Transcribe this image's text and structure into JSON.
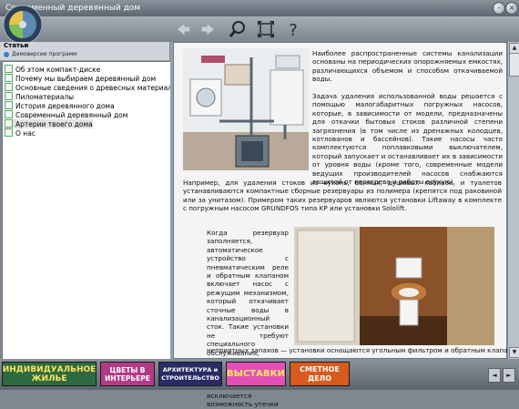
{
  "window": {
    "title": "Современный деревянный дом",
    "minimize_glyph": "–",
    "close_glyph": "×"
  },
  "toolbar": {
    "buttons": [
      "back-arrow-icon",
      "forward-arrow-icon",
      "search-magnifier-icon",
      "fullscreen-icon",
      "help-question-icon"
    ]
  },
  "sidebar": {
    "section_title": "Статьи",
    "section_subtitle": "Демоверсии программ",
    "items": [
      {
        "label": "Об этом компакт-диске",
        "selected": false
      },
      {
        "label": "Почему мы выбираем деревянный дом",
        "selected": false
      },
      {
        "label": "Основные сведения о древесных материалах",
        "selected": false
      },
      {
        "label": "Пиломатериалы",
        "selected": false
      },
      {
        "label": "История деревянного дома",
        "selected": false
      },
      {
        "label": "Современный деревянный дом",
        "selected": false
      },
      {
        "label": "Артерии твоего дома",
        "selected": true
      },
      {
        "label": "О нас",
        "selected": false
      }
    ]
  },
  "article": {
    "p1": "Наиболее распространенные системы канализации основаны на периодических опорожняемых емкостях, различающихся объемом и способом откачиваемой воды.",
    "p2": "Задача удаления использованной воды решается с помощью малогабаритных погружных насосов, которые, в зависимости от модели, предназначены для откачки бытовых стоков различной степени загрязнения (в том числе из дренажных колодцев, котлованов и бассейнов). Такие насосы часто комплектуются поплавковыми выключателем, который запускает и останавливает их в зависимости от уровня воды (кроме того, современные модели ведущих производителей насосов снабжаются защитой от перегрева и работы всухую).",
    "p3": "Например, для удаления стоков из кухонь, ванных, душевых кабинок, и туалетов устанавливаются компактные сборные резервуары из полимера (крепятся под раковиной или за унитазом). Примером таких резервуаров являются установки Liftaway в комплекте с погружным насосом GRUNDFOS типа KP или установки Sololift.",
    "p4": "Когда резервуар заполняется, автоматическое устройство с пневматическим реле и обратным клапаном включает насос с режущим механизмом, который откачивает сточные воды в канализационный сток. Такие установки не требуют специального обслуживания, поскольку их конструкция обеспечивает самоочистку. Также исключается возможность утечки",
    "p5": "неприятных запахов — установки оснащаются угольным фильтром и обратным клапаном."
  },
  "banners": [
    {
      "line1": "ИНДИВИДУАЛЬНОЕ",
      "line2": "ЖИЛЬЕ",
      "bg": "#2e6a3f",
      "fg": "#ffe45c"
    },
    {
      "line1": "ЦВЕТЫ В",
      "line2": "ИНТЕРЬЕРЕ",
      "bg": "#b33a86",
      "fg": "#ffffff"
    },
    {
      "line1": "АРХИТЕКТУРА и",
      "line2": "СТРОИТЕЛЬСТВО",
      "bg": "#2a2a66",
      "fg": "#ffffff"
    },
    {
      "line1": "ВЫСТАВКИ",
      "line2": "",
      "bg": "#e44fb6",
      "fg": "#ffe866"
    },
    {
      "line1": "СМЕТНОЕ",
      "line2": "ДЕЛО",
      "bg": "#d85a1c",
      "fg": "#ffffff"
    }
  ],
  "banner_scroll": {
    "left": "◄",
    "right": "►"
  },
  "scroll": {
    "up": "▲",
    "down": "▼"
  }
}
